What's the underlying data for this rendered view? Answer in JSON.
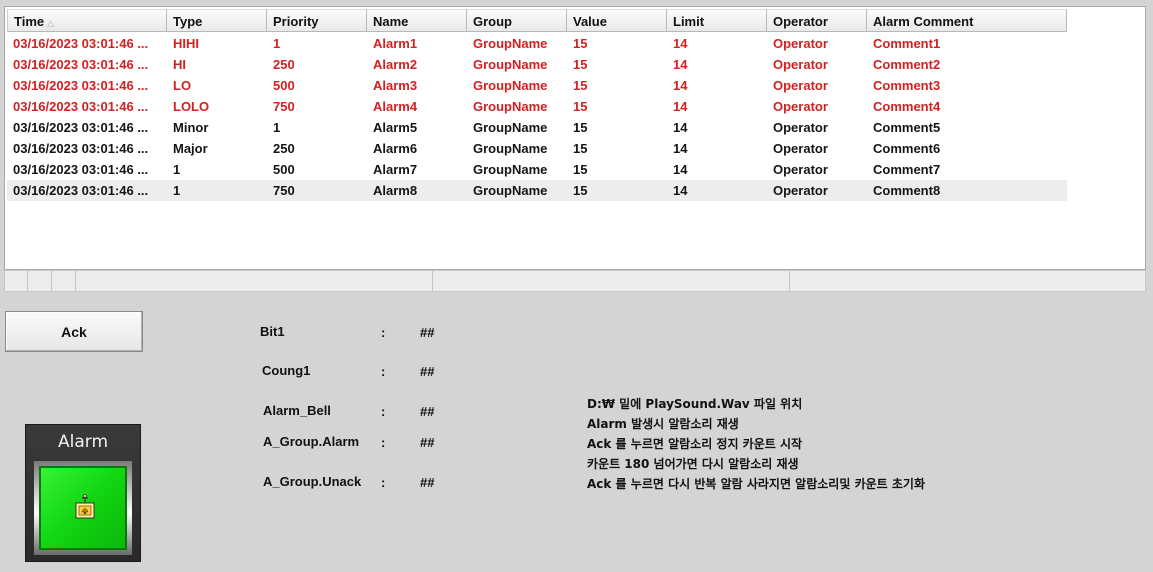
{
  "grid": {
    "columns": [
      {
        "label": "Time",
        "sorted": true
      },
      {
        "label": "Type"
      },
      {
        "label": "Priority"
      },
      {
        "label": "Name"
      },
      {
        "label": "Group"
      },
      {
        "label": "Value"
      },
      {
        "label": "Limit"
      },
      {
        "label": "Operator"
      },
      {
        "label": "Alarm Comment"
      }
    ],
    "rows": [
      {
        "state": "active",
        "selected": false,
        "cells": [
          "03/16/2023 03:01:46 ...",
          "HIHI",
          "1",
          "Alarm1",
          "GroupName",
          "15",
          "14",
          "Operator",
          "Comment1"
        ]
      },
      {
        "state": "active",
        "selected": false,
        "cells": [
          "03/16/2023 03:01:46 ...",
          "HI",
          "250",
          "Alarm2",
          "GroupName",
          "15",
          "14",
          "Operator",
          "Comment2"
        ]
      },
      {
        "state": "active",
        "selected": false,
        "cells": [
          "03/16/2023 03:01:46 ...",
          "LO",
          "500",
          "Alarm3",
          "GroupName",
          "15",
          "14",
          "Operator",
          "Comment3"
        ]
      },
      {
        "state": "active",
        "selected": false,
        "cells": [
          "03/16/2023 03:01:46 ...",
          "LOLO",
          "750",
          "Alarm4",
          "GroupName",
          "15",
          "14",
          "Operator",
          "Comment4"
        ]
      },
      {
        "state": "normal",
        "selected": false,
        "cells": [
          "03/16/2023 03:01:46 ...",
          "Minor",
          "1",
          "Alarm5",
          "GroupName",
          "15",
          "14",
          "Operator",
          "Comment5"
        ]
      },
      {
        "state": "normal",
        "selected": false,
        "cells": [
          "03/16/2023 03:01:46 ...",
          "Major",
          "250",
          "Alarm6",
          "GroupName",
          "15",
          "14",
          "Operator",
          "Comment6"
        ]
      },
      {
        "state": "normal",
        "selected": false,
        "cells": [
          "03/16/2023 03:01:46 ...",
          "1",
          "500",
          "Alarm7",
          "GroupName",
          "15",
          "14",
          "Operator",
          "Comment7"
        ]
      },
      {
        "state": "normal",
        "selected": true,
        "cells": [
          "03/16/2023 03:01:46 ...",
          "1",
          "750",
          "Alarm8",
          "GroupName",
          "15",
          "14",
          "Operator",
          "Comment8"
        ]
      }
    ],
    "colors": {
      "active_text": "#d42020",
      "normal_text": "#151515",
      "selected_row": "#ededed"
    },
    "sort_icon": "sort-ascending-icon"
  },
  "ack_button": {
    "label": "Ack"
  },
  "tags": [
    {
      "name": "Bit1",
      "colon": ":",
      "value": "##"
    },
    {
      "name": "Coung1",
      "colon": ":",
      "value": "##"
    },
    {
      "name": "Alarm_Bell",
      "colon": ":",
      "value": "##"
    },
    {
      "name": "A_Group.Alarm",
      "colon": ":",
      "value": "##"
    },
    {
      "name": "A_Group.Unack",
      "colon": ":",
      "value": "##"
    }
  ],
  "notes": [
    "D:₩ 밑에 PlaySound.Wav 파일 위치",
    "Alarm 발생시 알람소리 재생",
    "Ack 를 누르면 알람소리 정지 카운트 시작",
    "카운트 180 넘어가면 다시 알람소리 재생",
    "Ack 를 누르면 다시 반복 알람 사라지면 알람소리및 카운트 초기화"
  ],
  "alarm_panel": {
    "title": "Alarm",
    "lamp_color": "#12d612",
    "icon": "alarm-bell-icon"
  }
}
